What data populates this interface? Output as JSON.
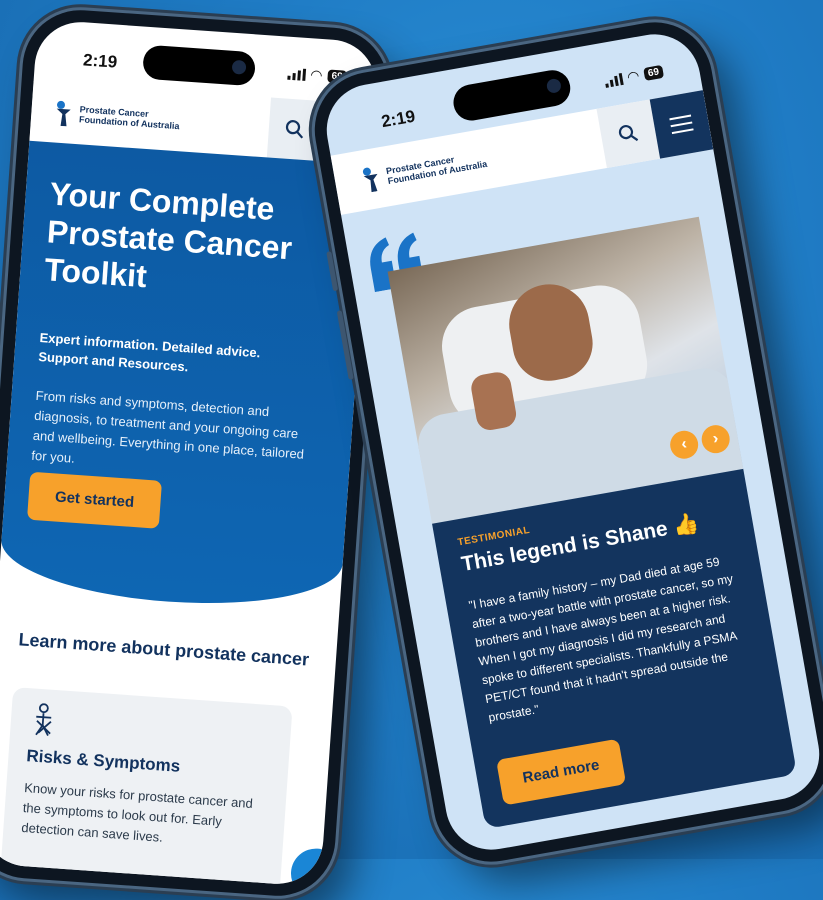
{
  "left_phone": {
    "status": {
      "time": "2:19",
      "battery": "69"
    },
    "header": {
      "logo_line1": "Prostate Cancer",
      "logo_line2": "Foundation of Australia"
    },
    "hero": {
      "title": "Your Complete Prostate Cancer Toolkit",
      "subtitle": "Expert information. Detailed advice. Support and Resources.",
      "body": "From risks and symptoms, detection and diagnosis, to treatment and your ongoing care and wellbeing. Everything in one place, tailored for you.",
      "cta": "Get started"
    },
    "learn": {
      "heading": "Learn more about prostate cancer",
      "card_title": "Risks & Symptoms",
      "card_body": "Know your risks for prostate cancer and the symptoms to look out for. Early detection can save lives."
    }
  },
  "right_phone": {
    "status": {
      "time": "2:19",
      "battery": "69"
    },
    "header": {
      "logo_line1": "Prostate Cancer",
      "logo_line2": "Foundation of Australia"
    },
    "testimonial": {
      "label": "TESTIMONIAL",
      "title": "This legend is Shane 👍",
      "quote": "\"I have a family history – my Dad died at age 59 after a two-year battle with prostate cancer, so my brothers and I have always been at a higher risk. When I got my diagnosis I did my research and spoke to different specialists. Thankfully a PSMA PET/CT found that it hadn't spread outside the prostate.\"",
      "cta": "Read more"
    }
  },
  "colors": {
    "navy": "#13345e",
    "blue": "#0e63ae",
    "orange": "#f7a12b",
    "background": "#1f7bc4"
  },
  "icons": [
    "search-icon",
    "menu-icon",
    "prev-arrow-icon",
    "next-arrow-icon",
    "quote-mark-icon",
    "person-ribbon-icon"
  ]
}
